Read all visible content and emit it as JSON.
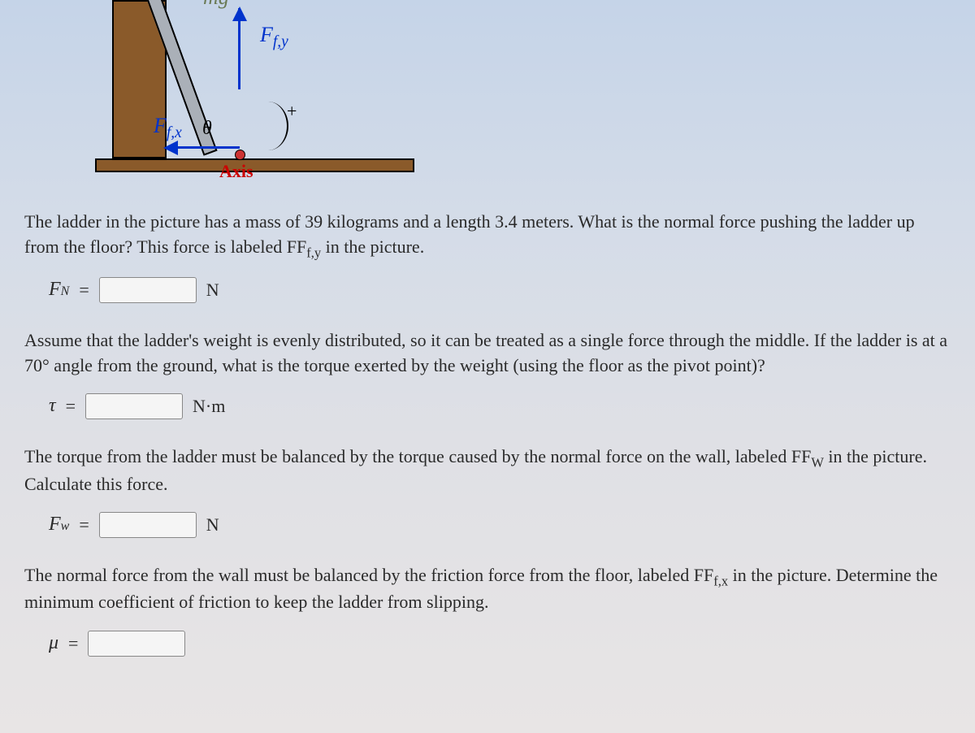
{
  "diagram": {
    "label_mg": "mg",
    "label_ffy": "Ff,y",
    "label_ffx": "Ff,x",
    "label_theta": "θ",
    "label_axis": "Axis",
    "label_plus": "+"
  },
  "paragraphs": {
    "p1_a": "The ladder in the picture has a mass of 39 kilograms and a length 3.4 meters. What is the normal force pushing the ladder up from the floor? This force is labeled F",
    "p1_sub": "f,y",
    "p1_b": " in the picture.",
    "p2": "Assume that the ladder's weight is evenly distributed, so it can be treated as a single force through the middle. If the ladder is at a 70° angle from the ground, what is the torque exerted by the weight (using the floor as the pivot point)?",
    "p3_a": "The torque from the ladder must be balanced by the torque caused by the normal force on the wall, labeled F",
    "p3_sub": "W",
    "p3_b": " in the picture. Calculate this force.",
    "p4_a": "The normal force from the wall must be balanced by the friction force from the floor, labeled F",
    "p4_sub": "f,x",
    "p4_b": " in the picture. Determine the minimum coefficient of friction to keep the ladder from slipping."
  },
  "inputs": {
    "fn": {
      "symbol": "F",
      "sub": "N",
      "eq": "=",
      "unit": "N",
      "value": ""
    },
    "tau": {
      "symbol": "τ",
      "sub": "",
      "eq": "=",
      "unit": "N·m",
      "value": ""
    },
    "fw": {
      "symbol": "F",
      "sub": "w",
      "eq": "=",
      "unit": "N",
      "value": ""
    },
    "mu": {
      "symbol": "μ",
      "sub": "",
      "eq": "=",
      "unit": "",
      "value": ""
    }
  }
}
